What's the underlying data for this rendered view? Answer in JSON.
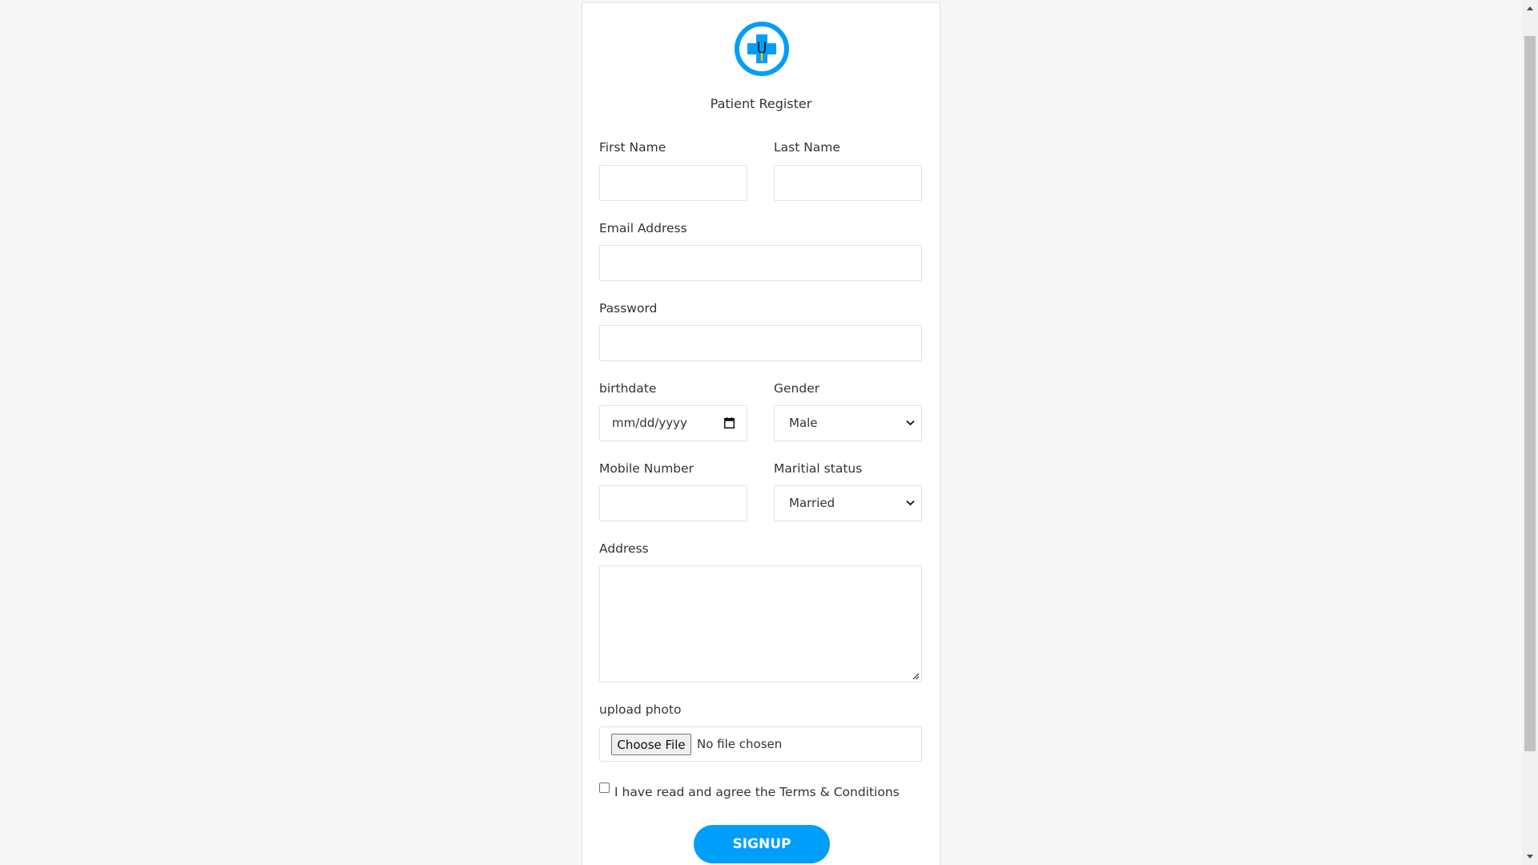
{
  "form": {
    "title": "Patient Register",
    "first_name": {
      "label": "First Name",
      "value": ""
    },
    "last_name": {
      "label": "Last Name",
      "value": ""
    },
    "email": {
      "label": "Email Address",
      "value": ""
    },
    "password": {
      "label": "Password",
      "value": ""
    },
    "birthdate": {
      "label": "birthdate",
      "placeholder": "mm/dd/yyyy"
    },
    "gender": {
      "label": "Gender",
      "selected": "Male"
    },
    "mobile": {
      "label": "Mobile Number",
      "value": ""
    },
    "marital": {
      "label": "Maritial status",
      "selected": "Married"
    },
    "address": {
      "label": "Address",
      "value": ""
    },
    "photo": {
      "label": "upload photo",
      "button": "Choose File",
      "status": "No file chosen"
    },
    "terms": {
      "text": "I have read and agree the Terms & Conditions",
      "checked": false
    },
    "submit_label": "SIGNUP"
  },
  "icons": {
    "logo": "medical-cross-stethoscope-icon",
    "calendar": "calendar-icon",
    "dropdown": "chevron-down-icon"
  },
  "colors": {
    "accent": "#009efb",
    "background": "#f7f7f7",
    "card": "#ffffff",
    "border": "#e3e3e3",
    "text": "#333333"
  }
}
